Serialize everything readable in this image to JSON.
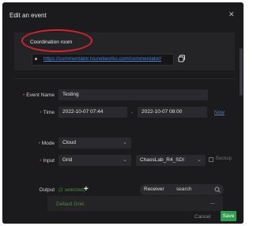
{
  "dialog": {
    "title": "Edit an event",
    "close_icon": "close-icon"
  },
  "coordination": {
    "label": "Coordination room",
    "link": "https://commentator.tvunetworks.com/commentator/",
    "copy_icon": "copy-icon"
  },
  "form": {
    "event_name": {
      "label": "Event Name",
      "value": "Testing"
    },
    "time": {
      "label": "Time",
      "start": "2022-10-07 07:44",
      "separator": "-",
      "end": "2022-10-07 08:00",
      "now_label": "Now"
    },
    "mode": {
      "label": "Mode",
      "value": "Cloud"
    },
    "input": {
      "label": "Input",
      "type": "Grid",
      "source": "ChaosLab_R4_SDI",
      "backup_label": "Backup"
    },
    "output": {
      "label": "Output",
      "selected": "(2 selected)",
      "add_symbol": "+",
      "filter": "Receiver",
      "search_value": "search",
      "list_item": "Default Grid",
      "more_symbol": "..."
    }
  },
  "footer": {
    "cancel_label": "Cancel",
    "save_label": "Save"
  },
  "colors": {
    "accent_green": "#2e9d4c",
    "link_blue": "#4a84d6",
    "required_red": "#c9443e",
    "highlight_red": "#d8232a"
  }
}
